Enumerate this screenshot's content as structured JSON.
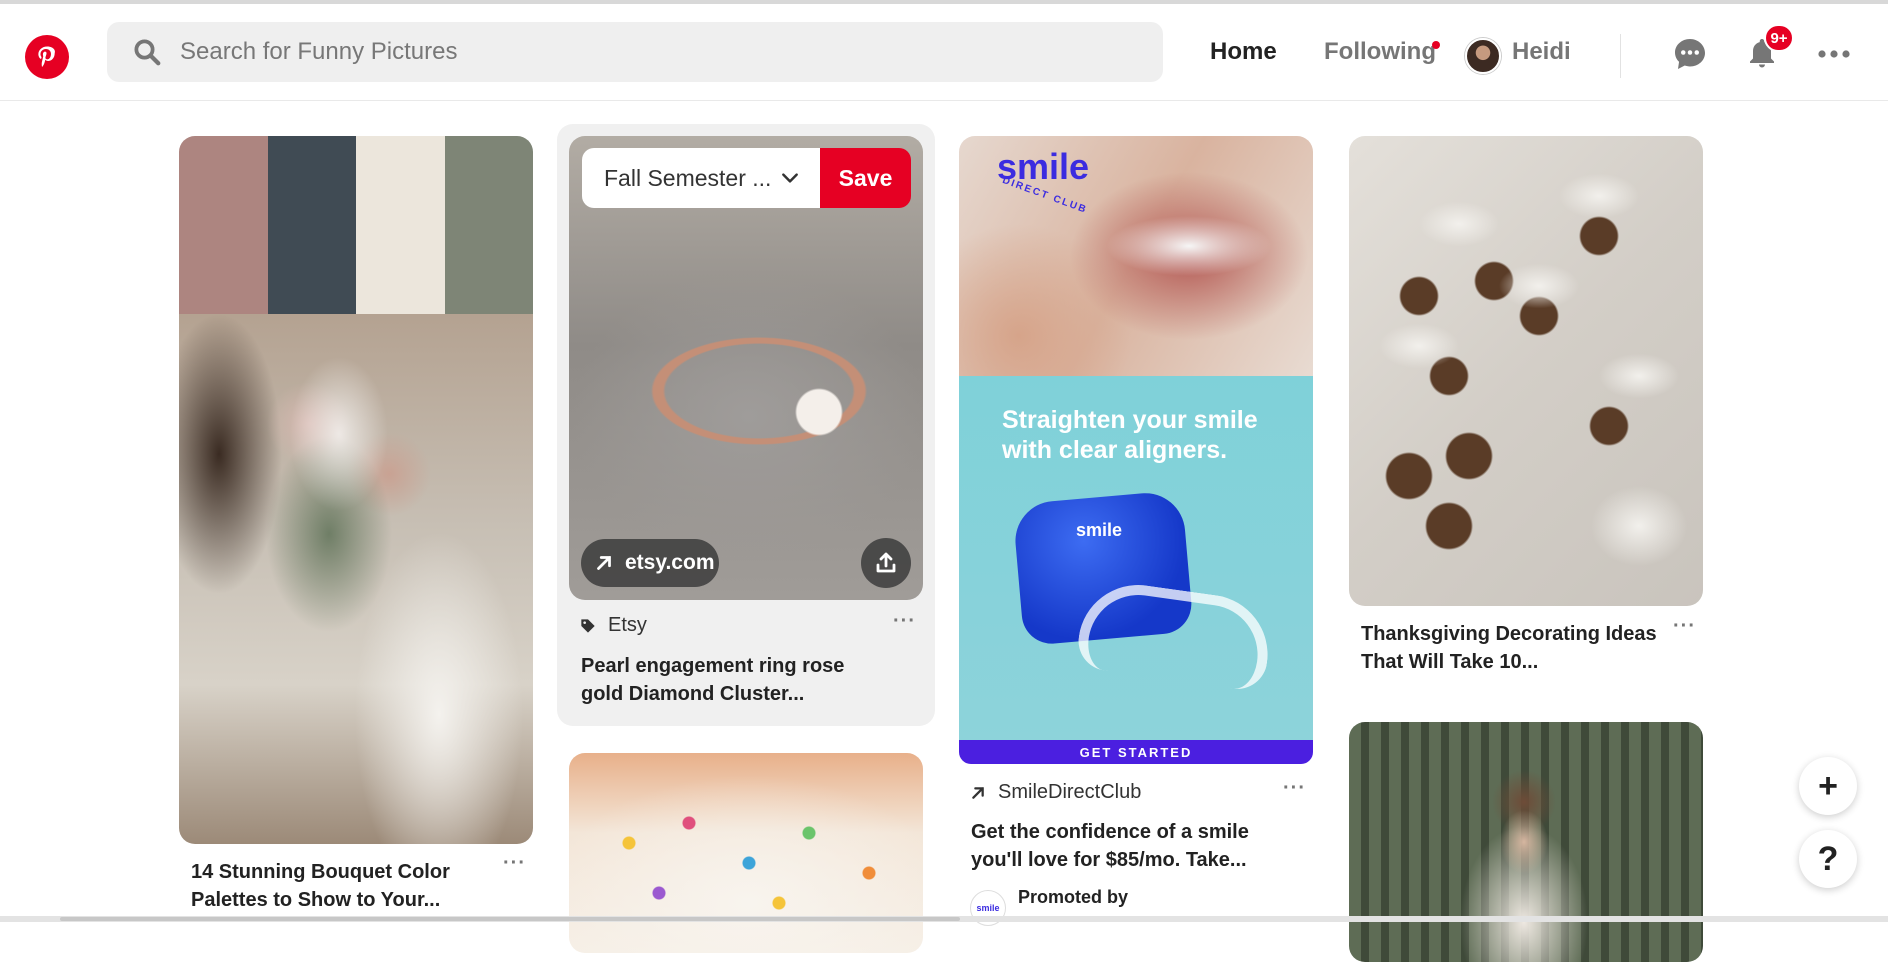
{
  "header": {
    "search_placeholder": "Search for Funny Pictures",
    "nav_home": "Home",
    "nav_following": "Following",
    "user_name": "Heidi",
    "notification_badge": "9+",
    "icons": [
      "pinterest-logo",
      "search-icon",
      "chat-icon",
      "bell-icon",
      "more-icon"
    ]
  },
  "pins": {
    "bouquet": {
      "title_line1": "14 Stunning Bouquet Color",
      "title_line2": "Palettes to Show to Your...",
      "palette": [
        "#ad8580",
        "#404b54",
        "#ece6dc",
        "#7e8576"
      ]
    },
    "ring": {
      "board_select": "Fall Semester ...",
      "save_label": "Save",
      "link_domain": "etsy.com",
      "source": "Etsy",
      "title_line1": "Pearl engagement ring rose",
      "title_line2": "gold Diamond Cluster..."
    },
    "ad": {
      "brand": "smile",
      "brand_sub": "DIRECT CLUB",
      "headline_line1": "Straighten your smile",
      "headline_line2": "with clear aligners.",
      "case_brand": "smile",
      "cta": "GET STARTED",
      "source": "SmileDirectClub",
      "title_line1": "Get the confidence of a smile",
      "title_line2": "you'll love for $85/mo. Take...",
      "promoted": "Promoted by",
      "promo_logo": "smile"
    },
    "tags": {
      "title_line1": "Thanksgiving Decorating Ideas",
      "title_line2": "That Will Take 10..."
    }
  },
  "floating": {
    "add_label": "+",
    "help_label": "?"
  },
  "colors": {
    "brand_red": "#e60023",
    "ad_purple": "#4b1fe0",
    "ad_teal": "#7fd1d9"
  }
}
